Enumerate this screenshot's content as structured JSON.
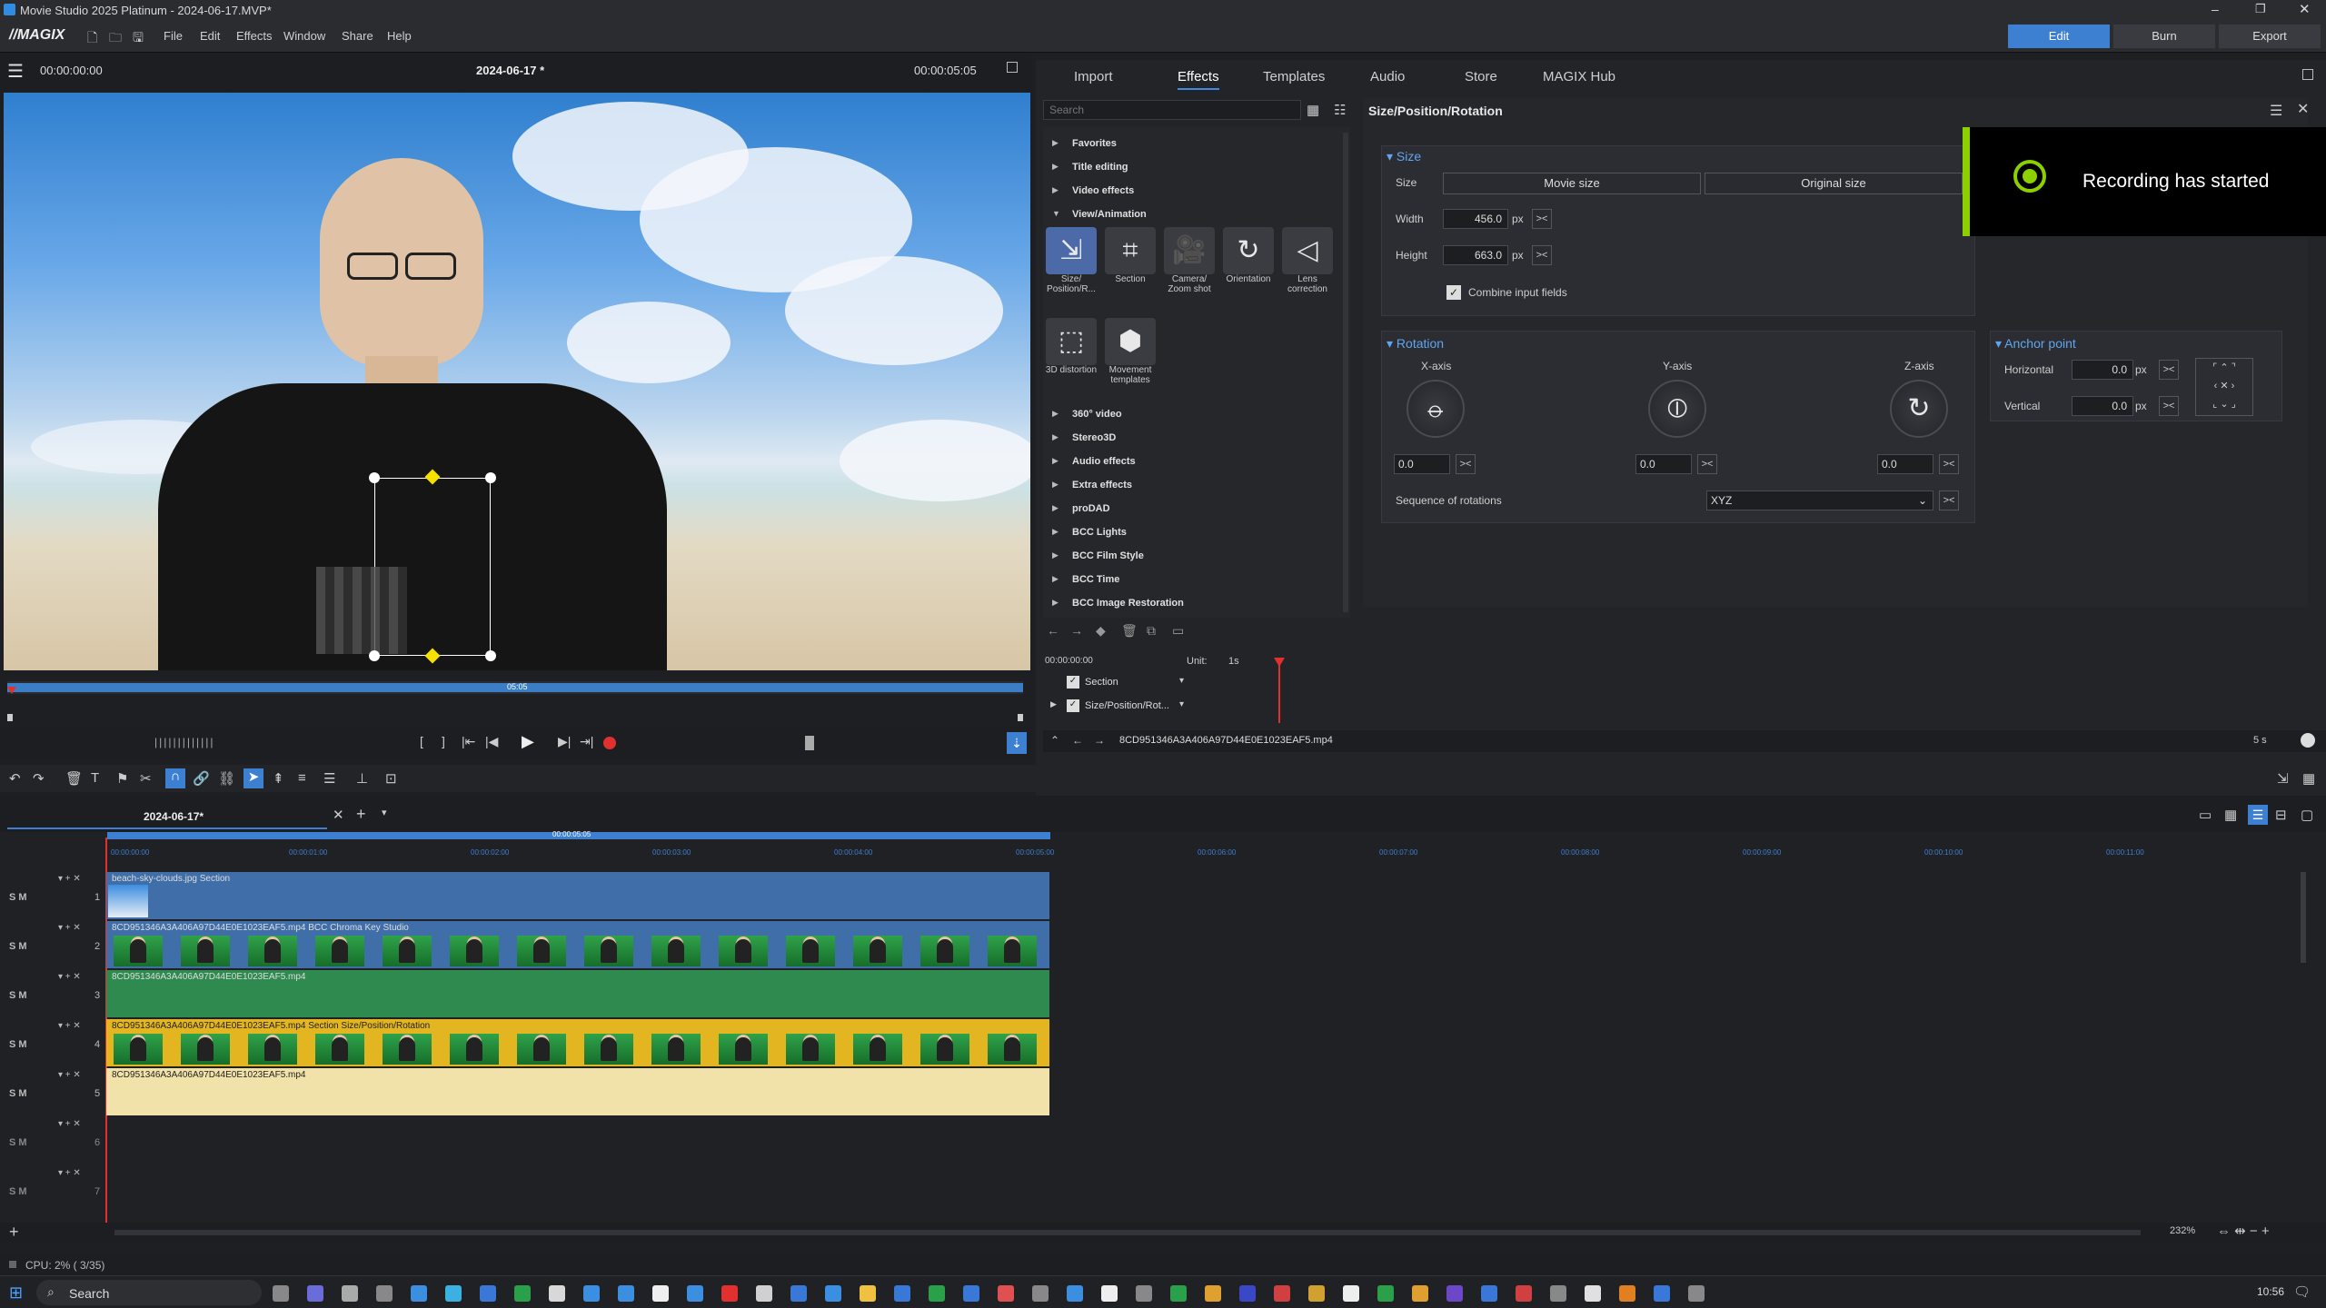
{
  "window": {
    "title": "Movie Studio 2025 Platinum - 2024-06-17.MVP*"
  },
  "menubar": {
    "logo": "//MAGIX",
    "items": [
      "File",
      "Edit",
      "Effects",
      "Window",
      "Share",
      "Help"
    ],
    "modes": [
      "Edit",
      "Burn",
      "Export"
    ],
    "active_mode": "Edit"
  },
  "preview": {
    "timecode_left": "00:00:00:00",
    "project_name": "2024-06-17 *",
    "timecode_right": "00:00:05:05",
    "scrub_label": "05:05"
  },
  "tabs": [
    "Import",
    "Effects",
    "Templates",
    "Audio",
    "Store",
    "MAGIX Hub"
  ],
  "active_tab": "Effects",
  "effects": {
    "search_placeholder": "Search",
    "categories_top": [
      "Favorites",
      "Title editing",
      "Video effects",
      "View/Animation"
    ],
    "view_animation_items": [
      {
        "label": "Size/ Position/R...",
        "icon": "size-position-icon",
        "glyph": "⇲"
      },
      {
        "label": "Section",
        "icon": "crop-icon",
        "glyph": "⌗"
      },
      {
        "label": "Camera/ Zoom shot",
        "icon": "camera-icon",
        "glyph": "🎥"
      },
      {
        "label": "Orientation",
        "icon": "orientation-icon",
        "glyph": "↻"
      },
      {
        "label": "Lens correction",
        "icon": "lens-icon",
        "glyph": "◁"
      },
      {
        "label": "3D distortion",
        "icon": "distortion-icon",
        "glyph": "⬚"
      },
      {
        "label": "Movement templates",
        "icon": "hexagon-icon",
        "glyph": "⬢"
      }
    ],
    "categories_bottom": [
      "360° video",
      "Stereo3D",
      "Audio effects",
      "Extra effects",
      "proDAD",
      "BCC Lights",
      "BCC Film Style",
      "BCC Time",
      "BCC Image Restoration"
    ]
  },
  "props": {
    "panel_title": "Size/Position/Rotation",
    "size": {
      "header": "Size",
      "size_label": "Size",
      "movie_size": "Movie size",
      "original_size": "Original size",
      "width_label": "Width",
      "width": "456.0",
      "height_label": "Height",
      "height": "663.0",
      "unit": "px",
      "combine": "Combine input fields"
    },
    "rotation": {
      "header": "Rotation",
      "x_label": "X-axis",
      "x": "0.0",
      "y_label": "Y-axis",
      "y": "0.0",
      "z_label": "Z-axis",
      "z": "0.0",
      "seq_label": "Sequence of rotations",
      "seq": "XYZ"
    },
    "anchor": {
      "header": "Anchor point",
      "h_label": "Horizontal",
      "h": "0.0",
      "v_label": "Vertical",
      "v": "0.0",
      "unit": "px"
    },
    "toast": "Recording has started"
  },
  "keyframes": {
    "timecode": "00:00:00:00",
    "unit_label": "Unit:",
    "unit": "1s",
    "rows": [
      "Section",
      "Size/Position/Rot..."
    ],
    "clipname": "8CD951346A3A406A97D44E0E1023EAF5.mp4",
    "zoom": "5 s"
  },
  "timeline": {
    "tab": "2024-06-17*",
    "ruler_top": "00:00:05:05",
    "ruler": [
      "00:00:00:00",
      "00:00:01:00",
      "00:00:02:00",
      "00:00:03:00",
      "00:00:04:00",
      "00:00:05:00",
      "00:00:06:00",
      "00:00:07:00",
      "00:00:08:00",
      "00:00:09:00",
      "00:00:10:00",
      "00:00:11:00"
    ],
    "track_controls": "S M",
    "tracks": [
      {
        "num": "1",
        "label": "beach-sky-clouds.jpg   Section",
        "color": "#3f6ea8"
      },
      {
        "num": "2",
        "label": "8CD951346A3A406A97D44E0E1023EAF5.mp4   BCC Chroma Key Studio",
        "color": "#3f6ea8"
      },
      {
        "num": "3",
        "label": "8CD951346A3A406A97D44E0E1023EAF5.mp4",
        "color": "#2f8a50"
      },
      {
        "num": "4",
        "label": "8CD951346A3A406A97D44E0E1023EAF5.mp4   Section   Size/Position/Rotation",
        "color": "#e3b520"
      },
      {
        "num": "5",
        "label": "8CD951346A3A406A97D44E0E1023EAF5.mp4",
        "color": "#f0e2a8"
      },
      {
        "num": "6",
        "label": "",
        "color": ""
      },
      {
        "num": "7",
        "label": "",
        "color": ""
      }
    ],
    "zoom": "232%"
  },
  "status": {
    "cpu": "CPU:  2% ( 3/35)"
  },
  "taskbar": {
    "search": "Search",
    "time": "10:56"
  }
}
